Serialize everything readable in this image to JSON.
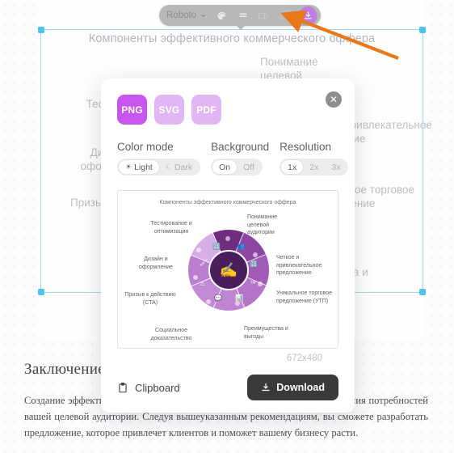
{
  "toolbar": {
    "font_name": "Roboto",
    "chevron": "⌄",
    "icons": [
      {
        "name": "palette-icon",
        "glyph": "◐"
      },
      {
        "name": "line-spacing-icon",
        "glyph": "☰"
      },
      {
        "name": "arrow-style-icon",
        "glyph": "➡"
      },
      {
        "name": "crop-icon",
        "glyph": "⬚"
      }
    ],
    "download_icon": "⬇",
    "download_title": "Download"
  },
  "canvas": {
    "diagram_title": "Компоненты эффективного коммерческого оффера",
    "labels": {
      "left_1": "Тестирование и",
      "left_2": "Дизайн и оформление",
      "left_3": "Призыв к действию (CTA)",
      "left_4": "Социальное",
      "right_1": "Понимание целевой",
      "right_2": "Четкое и привлекательное предложение",
      "right_3": "Уникальное торговое предложение",
      "right_4": "Преимущества и"
    }
  },
  "conclusion": {
    "heading": "Заключение",
    "body": "Создание эффективного коммерческого оффера требует времени и понимания потребностей вашей целевой аудитории. Следуя вышеуказанным рекомендациям, вы сможете разработать предложение, которое привлечет клиентов и поможет вашему бизнесу расти."
  },
  "modal": {
    "close_glyph": "✕",
    "formats": [
      {
        "label": "PNG",
        "selected": true
      },
      {
        "label": "SVG",
        "selected": false
      },
      {
        "label": "PDF",
        "selected": false
      }
    ],
    "options": [
      {
        "title": "Color mode",
        "items": [
          {
            "label": "Light",
            "glyph": "☀",
            "selected": true
          },
          {
            "label": "Dark",
            "glyph": "☾",
            "selected": false
          }
        ]
      },
      {
        "title": "Background",
        "items": [
          {
            "label": "On",
            "glyph": "",
            "selected": true
          },
          {
            "label": "Off",
            "glyph": "",
            "selected": false
          }
        ]
      },
      {
        "title": "Resolution",
        "items": [
          {
            "label": "1x",
            "glyph": "",
            "selected": true
          },
          {
            "label": "2x",
            "glyph": "",
            "selected": false
          },
          {
            "label": "3x",
            "glyph": "",
            "selected": false
          }
        ]
      }
    ],
    "dimensions": "672x480",
    "clipboard_label": "Clipboard",
    "clipboard_icon": "Ὄb",
    "download_label": "Download",
    "download_icon": "⬇"
  },
  "preview": {
    "title": "Компоненты эффективного коммерческого оффера",
    "labels": {
      "testing": "Тестирование и оптимизация",
      "audience": "Понимание целевой аудитории",
      "design": "Дизайн и оформление",
      "clear_offer": "Четкое и привлекательное предложение",
      "cta": "Призыв к действию (CTA)",
      "usp": "Уникальное торговое предложение (УТП)",
      "social_proof": "Социальное доказательство",
      "benefits": "Преимущества и выгоды"
    },
    "hub_icon": "✍"
  },
  "colors": {
    "accent_purple": "#c855f0",
    "accent_purple_light": "#e2b6f5",
    "download_dark": "#3a3a3c",
    "selection_blue": "#4cc3f0",
    "annotation_orange": "#e8791b"
  }
}
